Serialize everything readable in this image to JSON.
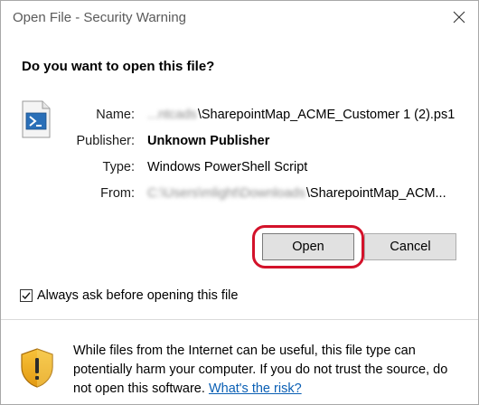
{
  "window": {
    "title": "Open File - Security Warning",
    "close_icon": "close-icon"
  },
  "heading": "Do you want to open this file?",
  "file_icon": "powershell-script-icon",
  "fields": {
    "name_label": "Name:",
    "name_redacted": "...ntcads",
    "name_value": "\\SharepointMap_ACME_Customer 1 (2).ps1",
    "publisher_label": "Publisher:",
    "publisher_value": "Unknown Publisher",
    "type_label": "Type:",
    "type_value": "Windows PowerShell Script",
    "from_label": "From:",
    "from_redacted": "C:\\Users\\mlight\\Downloads",
    "from_value": "\\SharepointMap_ACM..."
  },
  "buttons": {
    "open_label": "Open",
    "cancel_label": "Cancel"
  },
  "highlight_color": "#d3122a",
  "checkbox": {
    "label": "Always ask before opening this file",
    "checked": true
  },
  "warning": {
    "icon": "shield-warning-icon",
    "text": "While files from the Internet can be useful, this file type can potentially harm your computer. If you do not trust the source, do not open this software.",
    "link_text": "What's the risk?"
  }
}
